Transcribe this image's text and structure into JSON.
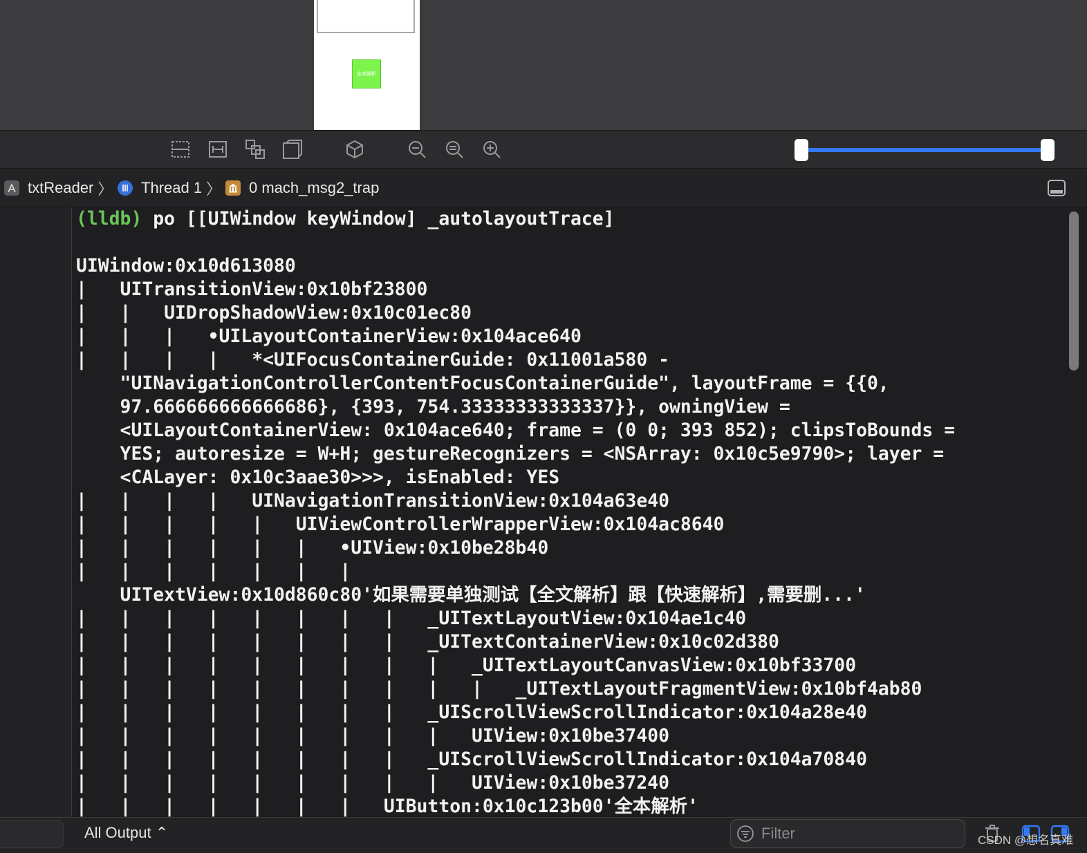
{
  "breadcrumb": {
    "app": "txtReader",
    "thread": "Thread 1",
    "frame": "0 mach_msg2_trap"
  },
  "console": {
    "prompt": "(lldb)",
    "command": "po [[UIWindow keyWindow] _autolayoutTrace]",
    "output_lines": [
      "",
      "UIWindow:0x10d613080",
      "|   UITransitionView:0x10bf23800",
      "|   |   UIDropShadowView:0x10c01ec80",
      "|   |   |   •UILayoutContainerView:0x104ace640",
      "|   |   |   |   *<UIFocusContainerGuide: 0x11001a580 -",
      "    \"UINavigationControllerContentFocusContainerGuide\", layoutFrame = {{0,",
      "    97.666666666666686}, {393, 754.33333333333337}}, owningView =",
      "    <UILayoutContainerView: 0x104ace640; frame = (0 0; 393 852); clipsToBounds =",
      "    YES; autoresize = W+H; gestureRecognizers = <NSArray: 0x10c5e9790>; layer =",
      "    <CALayer: 0x10c3aae30>>>, isEnabled: YES",
      "|   |   |   |   UINavigationTransitionView:0x104a63e40",
      "|   |   |   |   |   UIViewControllerWrapperView:0x104ac8640",
      "|   |   |   |   |   |   •UIView:0x10be28b40",
      "|   |   |   |   |   |   |",
      "    UITextView:0x10d860c80'如果需要单独测试【全文解析】跟【快速解析】,需要删...'",
      "|   |   |   |   |   |   |   |   _UITextLayoutView:0x104ae1c40",
      "|   |   |   |   |   |   |   |   _UITextContainerView:0x10c02d380",
      "|   |   |   |   |   |   |   |   |   _UITextLayoutCanvasView:0x10bf33700",
      "|   |   |   |   |   |   |   |   |   |   _UITextLayoutFragmentView:0x10bf4ab80",
      "|   |   |   |   |   |   |   |   _UIScrollViewScrollIndicator:0x104a28e40",
      "|   |   |   |   |   |   |   |   |   UIView:0x10be37400",
      "|   |   |   |   |   |   |   |   _UIScrollViewScrollIndicator:0x104a70840",
      "|   |   |   |   |   |   |   |   |   UIView:0x10be37240",
      "|   |   |   |   |   |   |   UIButton:0x10c123b00'全本解析'"
    ]
  },
  "bottom": {
    "output_selector": "All Output ⌃",
    "filter_placeholder": "Filter",
    "watermark": "CSDN @想名真难"
  },
  "canvas": {
    "button_label": "全本解析"
  },
  "colors": {
    "accent": "#3478f6",
    "prompt_green": "#6cc45a",
    "device_button": "#7cf44b"
  }
}
